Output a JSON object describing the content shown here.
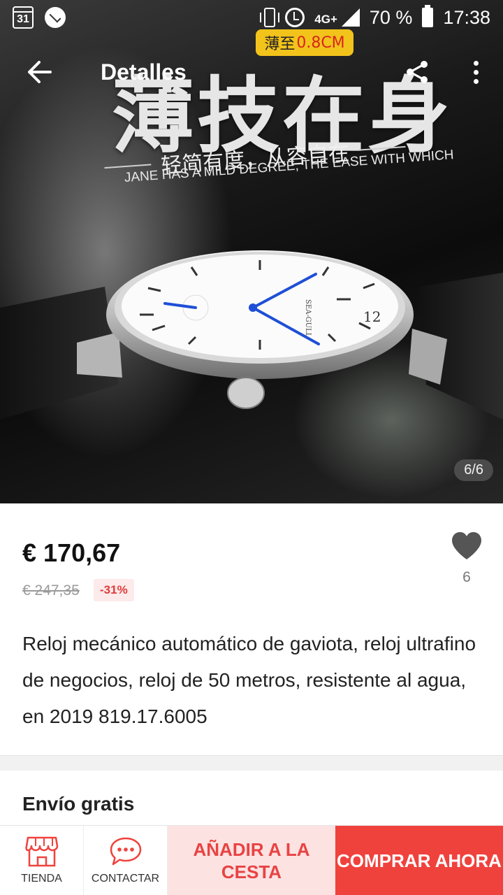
{
  "status_bar": {
    "calendar_day": "31",
    "network": "4G+",
    "battery": "70 %",
    "time": "17:38",
    "icons": [
      "calendar-icon",
      "sync-icon",
      "vibrate-icon",
      "alarm-icon",
      "signal-icon",
      "battery-icon"
    ]
  },
  "app_bar": {
    "title": "Detalles",
    "back_icon": "arrow-left-icon",
    "share_icon": "share-icon",
    "more_icon": "more-vertical-icon"
  },
  "hero": {
    "badge_prefix": "薄至",
    "badge_value": "0.8CM",
    "headline": "薄技在身",
    "subline_cn": "轻简有度，从容自在",
    "subline_en": "JANE HAS A MILD DEGREE, THE EASE WITH WHICH",
    "watch_brand": "SEA-GULL",
    "dial_numeral": "12",
    "counter": "6/6"
  },
  "product": {
    "price": "€ 170,67",
    "old_price": "€ 247,35",
    "discount": "-31%",
    "wish_count": "6",
    "title": "Reloj mecánico automático de gaviota, reloj ultrafino de negocios, reloj de 50 metros, resistente al agua, en 2019 819.17.6005"
  },
  "shipping": {
    "label": "Envío gratis"
  },
  "bottom_bar": {
    "store_label": "TIENDA",
    "contact_label": "CONTACTAR",
    "add_to_cart": "AÑADIR A LA CESTA",
    "buy_now": "COMPRAR AHORA"
  },
  "colors": {
    "accent": "#f0423d",
    "accent_light": "#fde2e2",
    "discount_text": "#e03c3c",
    "badge": "#f2c31b",
    "hand_blue": "#1e4fd6"
  }
}
